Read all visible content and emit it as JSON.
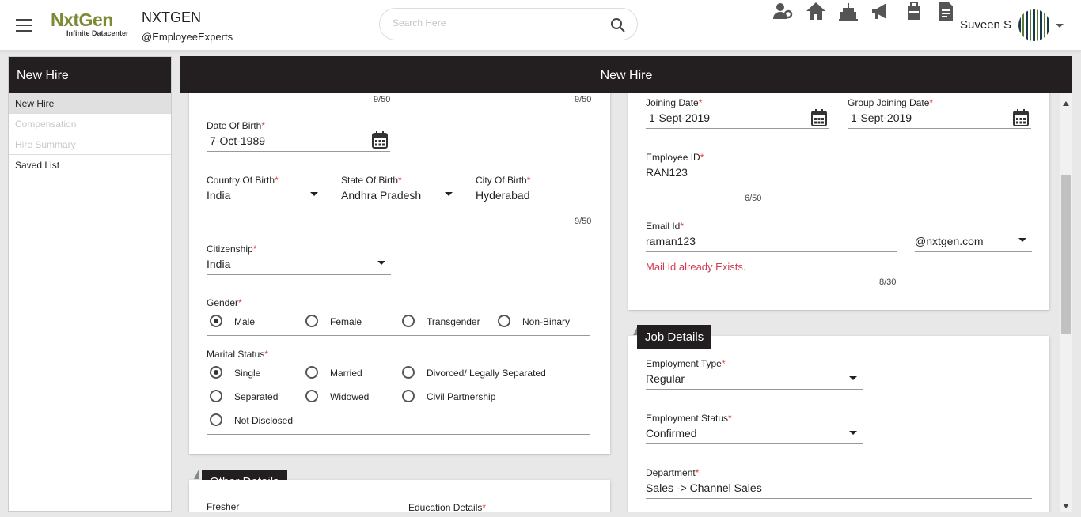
{
  "header": {
    "logo_main": "NxtGen",
    "logo_sub": "Infinite Datacenter",
    "company_name": "NXTGEN",
    "company_handle": "@EmployeeExperts",
    "search_placeholder": "Search Here",
    "user_name": "Suveen S",
    "icons": [
      "people-settings-icon",
      "home-icon",
      "birthday-cake-icon",
      "megaphone-icon",
      "suitcase-icon",
      "document-icon"
    ]
  },
  "sidebar": {
    "title": "New Hire",
    "items": [
      {
        "label": "New Hire",
        "state": "active"
      },
      {
        "label": "Compensation",
        "state": "disabled"
      },
      {
        "label": "Hire Summary",
        "state": "disabled"
      },
      {
        "label": "Saved List",
        "state": "normal"
      }
    ]
  },
  "main": {
    "title": "New Hire"
  },
  "personal": {
    "counter_top_left": "9/50",
    "counter_top_right": "9/50",
    "dob_label": "Date Of Birth",
    "dob_value": "7-Oct-1989",
    "country_label": "Country Of Birth",
    "country_value": "India",
    "state_label": "State Of Birth",
    "state_value": "Andhra Pradesh",
    "city_label": "City Of Birth",
    "city_value": "Hyderabad",
    "city_counter": "9/50",
    "citizenship_label": "Citizenship",
    "citizenship_value": "India",
    "gender_label": "Gender",
    "gender_options": [
      "Male",
      "Female",
      "Transgender",
      "Non-Binary"
    ],
    "gender_selected": "Male",
    "marital_label": "Marital Status",
    "marital_options": [
      "Single",
      "Married",
      "Divorced/ Legally Separated",
      "Separated",
      "Widowed",
      "Civil Partnership",
      "Not Disclosed"
    ],
    "marital_selected": "Single"
  },
  "other_details": {
    "section_title": "Other Details",
    "fresher_label": "Fresher",
    "education_label": "Education Details"
  },
  "employment": {
    "joining_label": "Joining Date",
    "joining_value": "1-Sept-2019",
    "group_joining_label": "Group Joining Date",
    "group_joining_value": "1-Sept-2019",
    "emp_id_label": "Employee ID",
    "emp_id_value": "RAN123",
    "emp_id_counter": "6/50",
    "email_label": "Email Id",
    "email_value": "raman123",
    "email_domain": "@nxtgen.com",
    "email_error": "Mail Id already Exists.",
    "email_counter": "8/30"
  },
  "job_details": {
    "section_title": "Job Details",
    "type_label": "Employment Type",
    "type_value": "Regular",
    "status_label": "Employment Status",
    "status_value": "Confirmed",
    "dept_label": "Department",
    "dept_value": "Sales -> Channel Sales"
  },
  "colors": {
    "dark_header": "#231f20",
    "brand_green": "#7b8b35",
    "required_red": "#e53935",
    "error_red": "#d23b53"
  }
}
